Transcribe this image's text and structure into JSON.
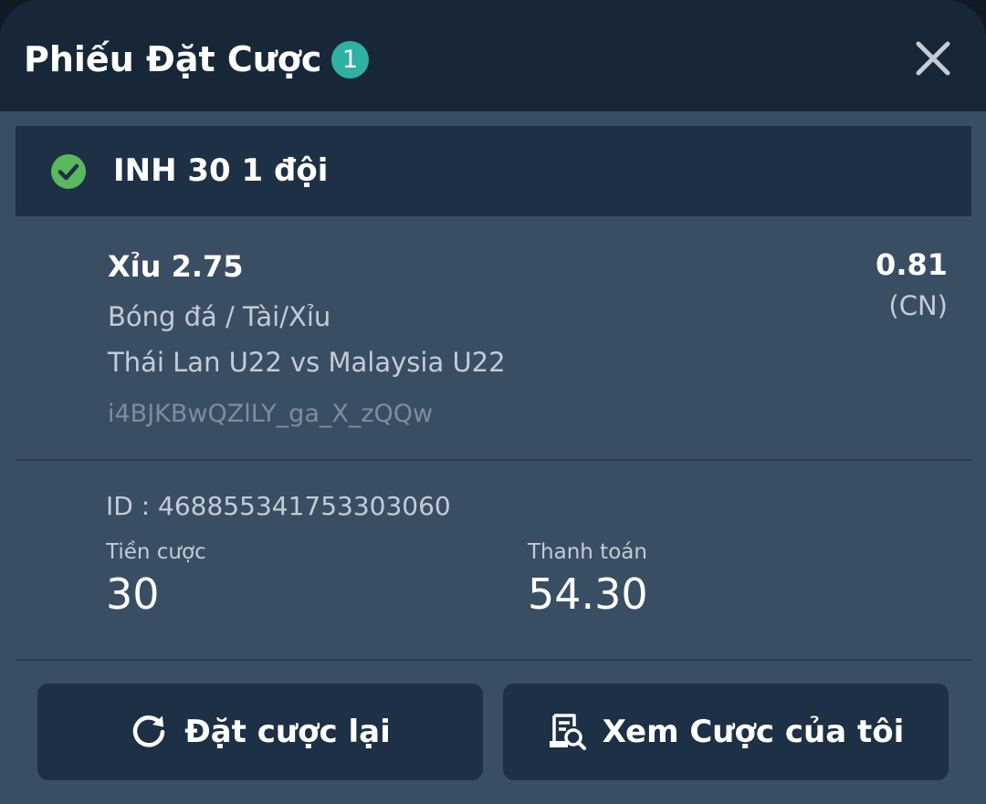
{
  "header": {
    "title": "Phiếu Đặt Cược",
    "count": "1"
  },
  "status": {
    "text": "INH 30 1 đội",
    "icon": "check-circle-icon",
    "color": "#5cb85c"
  },
  "bet": {
    "selection": "Xỉu 2.75",
    "odds": "0.81",
    "odds_type": "(CN)",
    "market": "Bóng đá / Tài/Xỉu",
    "match": "Thái Lan U22 vs Malaysia U22",
    "reference": "i4BJKBwQZlLY_ga_X_zQQw"
  },
  "summary": {
    "id_text": "ID : 468855341753303060",
    "stake_label": "Tiền cược",
    "stake_value": "30",
    "payout_label": "Thanh toán",
    "payout_value": "54.30"
  },
  "actions": {
    "rebet_label": "Đặt cược lại",
    "my_bets_label": "Xem Cược của tôi"
  },
  "colors": {
    "header_bg": "#172737",
    "panel_bg": "#3a4e63",
    "bar_bg": "#1d3045",
    "badge": "#2fb0a3"
  }
}
